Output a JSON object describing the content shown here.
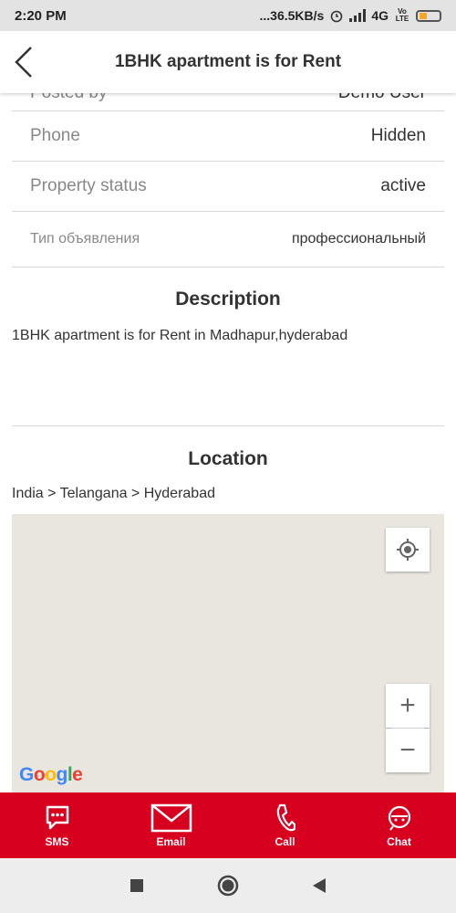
{
  "status_bar": {
    "time": "2:20 PM",
    "network_speed": "...36.5KB/s",
    "network_type": "4G",
    "volte": "Vo LTE"
  },
  "app_bar": {
    "title": "1BHK apartment is for Rent",
    "back_icon": "chevron-left-icon"
  },
  "details": {
    "partial_row": {
      "label": "Posted by",
      "value": "Demo User"
    },
    "rows": [
      {
        "label": "Phone",
        "value": "Hidden"
      },
      {
        "label": "Property status",
        "value": "active"
      },
      {
        "label": "Тип объявления",
        "value": "профессиональный"
      }
    ]
  },
  "description": {
    "title": "Description",
    "text": "1BHK apartment is for Rent in Madhapur,hyderabad"
  },
  "location": {
    "title": "Location",
    "breadcrumb": "India > Telangana > Hyderabad",
    "map": {
      "zoom_in": "+",
      "zoom_out": "−",
      "google_logo": "Google"
    }
  },
  "bottom_bar": {
    "items": [
      {
        "label": "SMS",
        "icon": "sms-icon"
      },
      {
        "label": "Email",
        "icon": "email-icon"
      },
      {
        "label": "Call",
        "icon": "phone-icon"
      },
      {
        "label": "Chat",
        "icon": "chat-icon"
      }
    ]
  },
  "colors": {
    "accent": "#d8001f",
    "map_background": "#e9e6df"
  }
}
